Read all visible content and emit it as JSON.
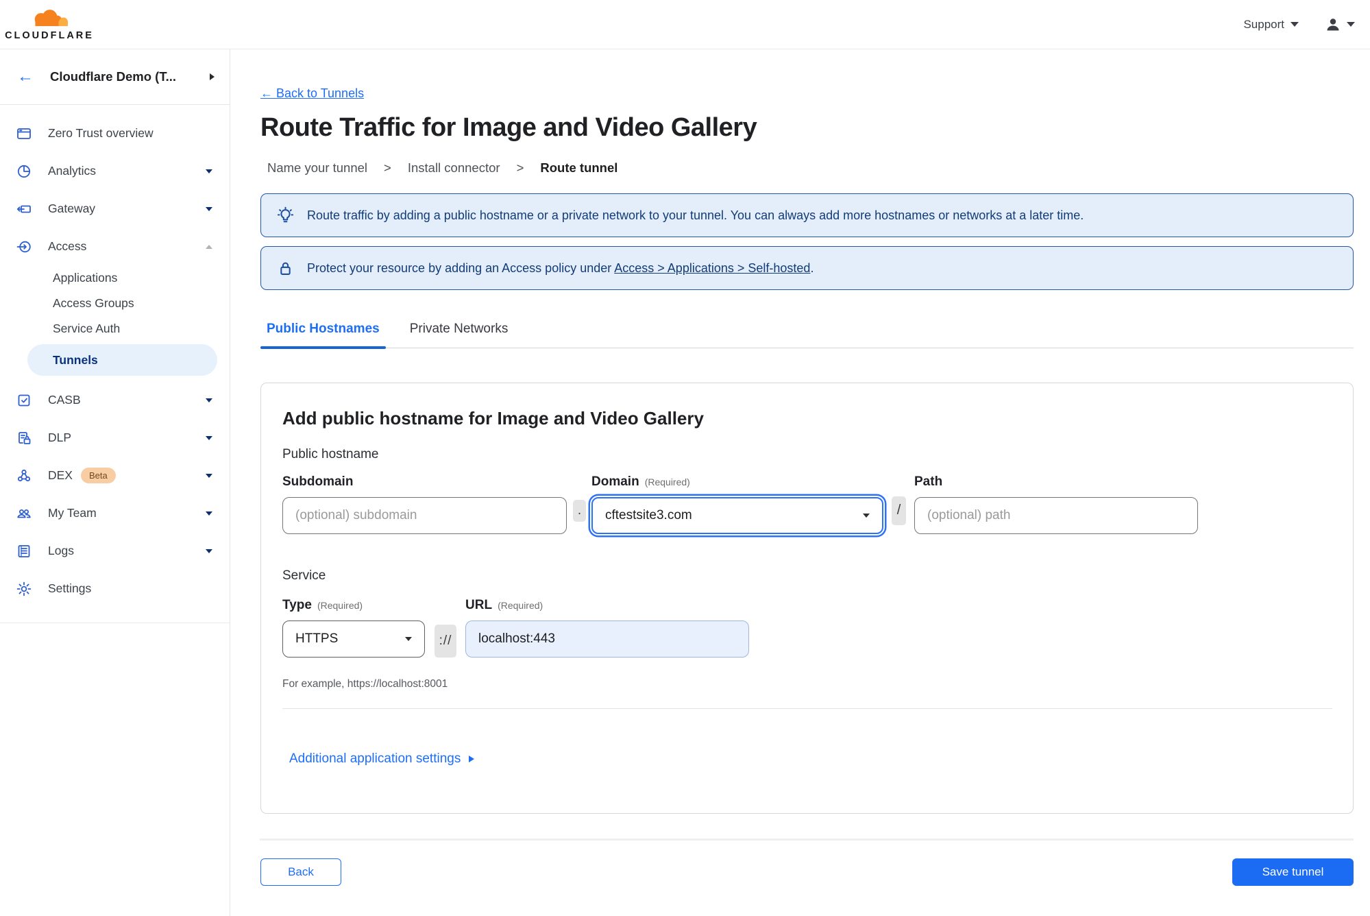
{
  "header": {
    "brand": "CLOUDFLARE",
    "support": "Support"
  },
  "sidebar": {
    "back_arrow": "←",
    "account_name": "Cloudflare Demo (T...",
    "items": [
      {
        "label": "Zero Trust overview"
      },
      {
        "label": "Analytics"
      },
      {
        "label": "Gateway"
      },
      {
        "label": "Access"
      },
      {
        "label": "Applications"
      },
      {
        "label": "Access Groups"
      },
      {
        "label": "Service Auth"
      },
      {
        "label": "Tunnels"
      },
      {
        "label": "CASB"
      },
      {
        "label": "DLP"
      },
      {
        "label": "DEX",
        "badge": "Beta"
      },
      {
        "label": "My Team"
      },
      {
        "label": "Logs"
      },
      {
        "label": "Settings"
      }
    ]
  },
  "page": {
    "back_link": "← Back to Tunnels",
    "title": "Route Traffic for Image and Video Gallery",
    "steps": [
      "Name your tunnel",
      "Install connector",
      "Route tunnel"
    ],
    "step_separator": ">",
    "banners": [
      {
        "icon": "lightbulb-icon",
        "text": "Route traffic by adding a public hostname or a private network to your tunnel. You can always add more hostnames or networks at a later time."
      },
      {
        "icon": "lock-icon",
        "text_before": "Protect your resource by adding an Access policy under ",
        "link": "Access > Applications > Self-hosted",
        "text_after": "."
      }
    ],
    "tabs": [
      {
        "label": "Public Hostnames"
      },
      {
        "label": "Private Networks"
      }
    ]
  },
  "form": {
    "heading": "Add public hostname for Image and Video Gallery",
    "public_hostname_section": "Public hostname",
    "subdomain_label": "Subdomain",
    "domain_label": "Domain",
    "path_label": "Path",
    "required_hint": "(Required)",
    "subdomain_placeholder": "(optional) subdomain",
    "domain_value": "cftestsite3.com",
    "path_placeholder": "(optional) path",
    "dot_separator": ".",
    "slash_separator": "/",
    "service_section": "Service",
    "type_label": "Type",
    "url_label": "URL",
    "type_value": "HTTPS",
    "scheme_separator": "://",
    "url_value": "localhost:443",
    "example_text": "For example, https://localhost:8001",
    "additional_settings_label": "Additional application settings"
  },
  "footer": {
    "back_label": "Back",
    "save_label": "Save tunnel"
  },
  "colors": {
    "primary_blue": "#1b6cf2",
    "link_blue": "#1e6ef5",
    "banner_bg": "#e4eefa",
    "banner_border": "#2456a6",
    "banner_text": "#123c78",
    "selected_item_bg": "#e7f1fc",
    "selected_item_text": "#0a3180",
    "sidebar_icon_blue": "#2d5fd0",
    "beta_badge_bg": "#f9cda4",
    "logo_orange": "#f6821f",
    "logo_light_orange": "#fbad41"
  }
}
